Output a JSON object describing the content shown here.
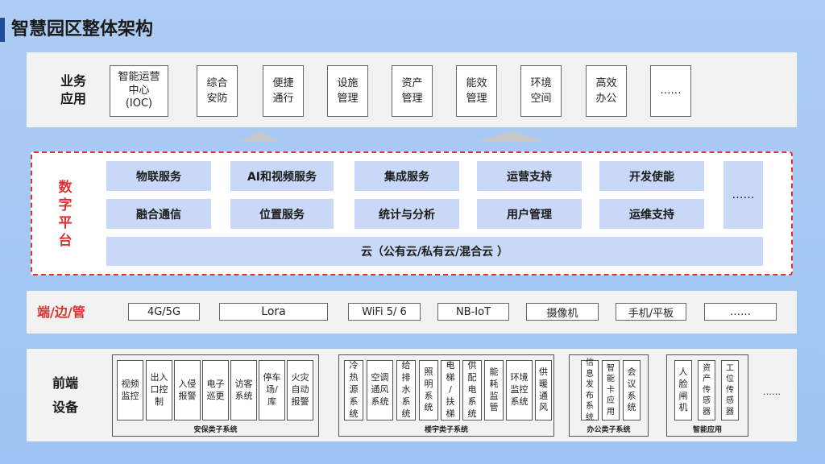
{
  "title": "智慧园区整体架构",
  "biz": {
    "label": "业务\n应用",
    "items": [
      "智能运营\n中心\n(IOC)",
      "综合\n安防",
      "便捷\n通行",
      "设施\n管理",
      "资产\n管理",
      "能效\n管理",
      "环境\n空间",
      "高效\n办公",
      "……"
    ]
  },
  "digital": {
    "label": "数\n字\n平\n台",
    "row1": [
      "物联服务",
      "AI和视频服务",
      "集成服务",
      "运营支持",
      "开发使能"
    ],
    "row2": [
      "融合通信",
      "位置服务",
      "统计与分析",
      "用户管理",
      "运维支持"
    ],
    "more": "……",
    "cloud": "云（公有云/私有云/混合云 ）"
  },
  "edge": {
    "label": "端/边/管",
    "items": [
      "4G/5G",
      "Lora",
      "WiFi 5/ 6",
      "NB-IoT",
      "摄像机",
      "手机/平板",
      "……"
    ]
  },
  "front": {
    "label": "前端\n\n设备",
    "groups": [
      {
        "caption": "安保类子系统",
        "items": [
          "视频\n监控",
          "出入\n口控\n制",
          "入侵\n报警",
          "电子\n巡更",
          "访客\n系统",
          "停车\n场/\n库",
          "火灾\n自动\n报警"
        ]
      },
      {
        "caption": "楼宇类子系统",
        "items": [
          "冷\n热\n源\n系\n统",
          "空调\n通风\n系统",
          "给\n排\n水\n系\n统",
          "照\n明\n系\n统",
          "电\n梯\n/\n扶\n梯",
          "供\n配\n电\n系\n统",
          "能\n耗\n监\n管",
          "环境\n监控\n系统",
          "供\n暖\n通\n风"
        ]
      },
      {
        "caption": "办公类子系统",
        "items": [
          "信\n息\n发\n布\n系\n统",
          "智\n能\n卡\n应\n用",
          "会\n议\n系\n统"
        ]
      },
      {
        "caption": "智能应用",
        "items": [
          "人\n脸\n闸\n机",
          "资\n产\n传\n感\n器",
          "工\n位\n传\n感\n器"
        ]
      }
    ],
    "more": "……"
  },
  "colors": {
    "accent": "#1f4e99",
    "red": "#e03030",
    "service": "#c9d8f6"
  }
}
